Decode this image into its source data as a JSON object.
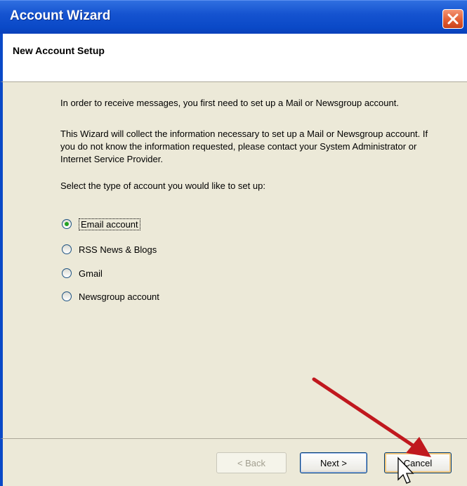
{
  "window": {
    "title": "Account Wizard"
  },
  "header": {
    "title": "New Account Setup"
  },
  "body": {
    "intro1": "In order to receive messages, you first need to set up a Mail or Newsgroup account.",
    "intro2": "This Wizard will collect the information necessary to set up a Mail or Newsgroup account. If you do not know the information requested, please contact your System Administrator or Internet Service Provider.",
    "select_label": "Select the type of account you would like to set up:"
  },
  "options": [
    {
      "label": "Email account",
      "checked": true
    },
    {
      "label": "RSS News & Blogs",
      "checked": false
    },
    {
      "label": "Gmail",
      "checked": false
    },
    {
      "label": "Newsgroup account",
      "checked": false
    }
  ],
  "buttons": {
    "back": "< Back",
    "next": "Next >",
    "cancel": "Cancel"
  },
  "colors": {
    "titlebar": "#0a49c7",
    "dialog_bg": "#ece9d8",
    "annotation_arrow": "#c0181e",
    "radio_checked_dot": "#21a121"
  },
  "icons": {
    "close": "close-icon",
    "cursor": "mouse-pointer-icon"
  }
}
